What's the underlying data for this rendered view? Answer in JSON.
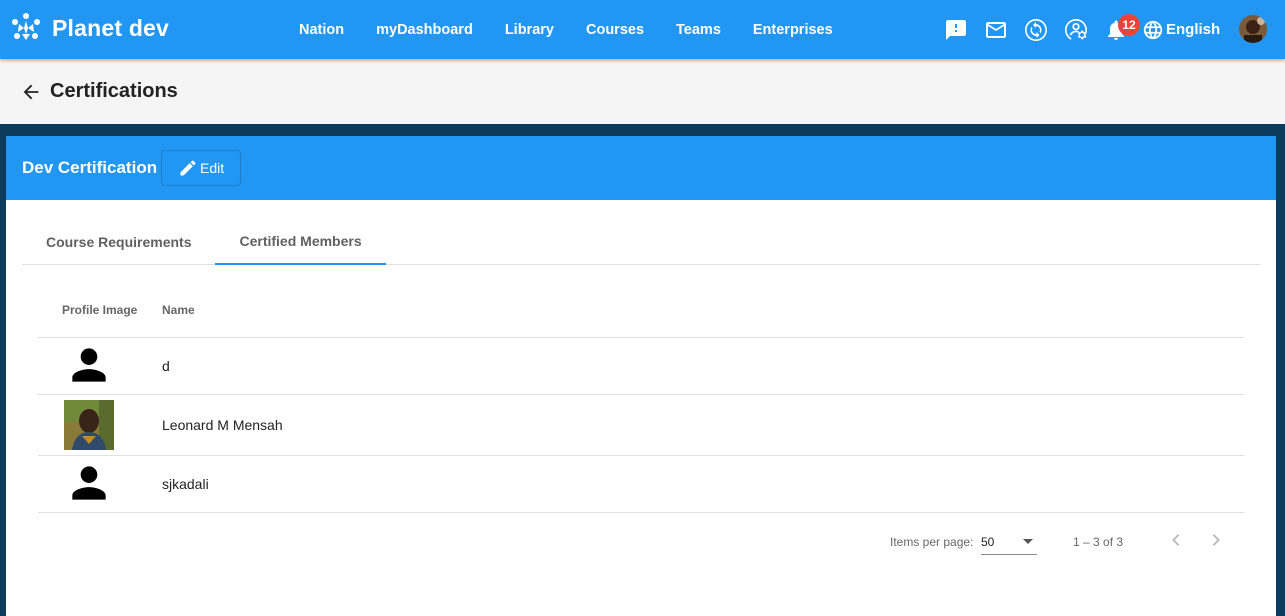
{
  "app": {
    "name": "Planet dev"
  },
  "nav": {
    "items": [
      "Nation",
      "myDashboard",
      "Library",
      "Courses",
      "Teams",
      "Enterprises"
    ]
  },
  "toolbar": {
    "notification_count": "12",
    "language": "English"
  },
  "page": {
    "title": "Certifications"
  },
  "certification": {
    "name": "Dev Certification",
    "edit_label": "Edit"
  },
  "tabs": [
    {
      "label": "Course Requirements",
      "active": false
    },
    {
      "label": "Certified Members",
      "active": true
    }
  ],
  "table": {
    "headers": {
      "image": "Profile Image",
      "name": "Name"
    },
    "rows": [
      {
        "name": "d",
        "image": "person-icon"
      },
      {
        "name": "Leonard M Mensah",
        "image": "photo"
      },
      {
        "name": "sjkadali",
        "image": "person-icon"
      }
    ]
  },
  "paginator": {
    "items_label": "Items per page:",
    "page_size": "50",
    "range": "1 – 3 of 3"
  },
  "colors": {
    "primary": "#2196f3",
    "badge": "#f44336",
    "header_bg": "#f5f5f5"
  }
}
